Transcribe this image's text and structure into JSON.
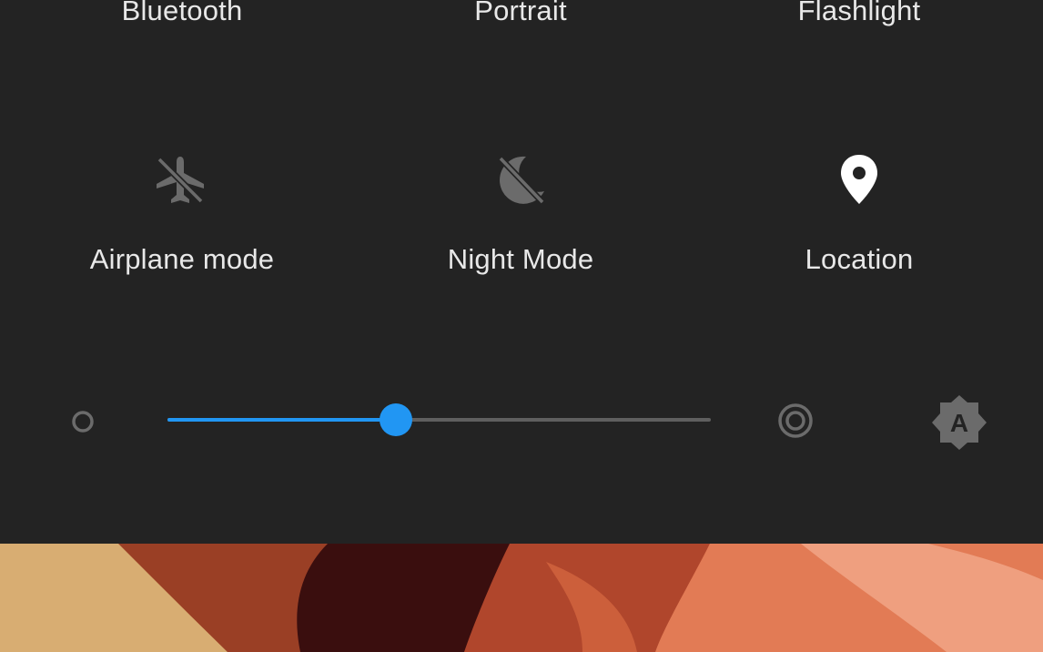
{
  "quick_settings": {
    "top_row": [
      {
        "label": "Bluetooth"
      },
      {
        "label": "Portrait"
      },
      {
        "label": "Flashlight"
      }
    ],
    "middle_row": [
      {
        "label": "Airplane mode",
        "icon": "airplane-off-icon",
        "state": "off"
      },
      {
        "label": "Night Mode",
        "icon": "night-mode-off-icon",
        "state": "off"
      },
      {
        "label": "Location",
        "icon": "location-pin-icon",
        "state": "on"
      }
    ]
  },
  "brightness": {
    "level": 0.42,
    "auto_icon": "auto-brightness-icon",
    "auto_letter": "A"
  },
  "colors": {
    "panel_bg": "#232323",
    "accent": "#2196f3",
    "active_icon": "#ffffff",
    "inactive_icon": "#6b6b6b",
    "label": "#e8e8e8"
  }
}
